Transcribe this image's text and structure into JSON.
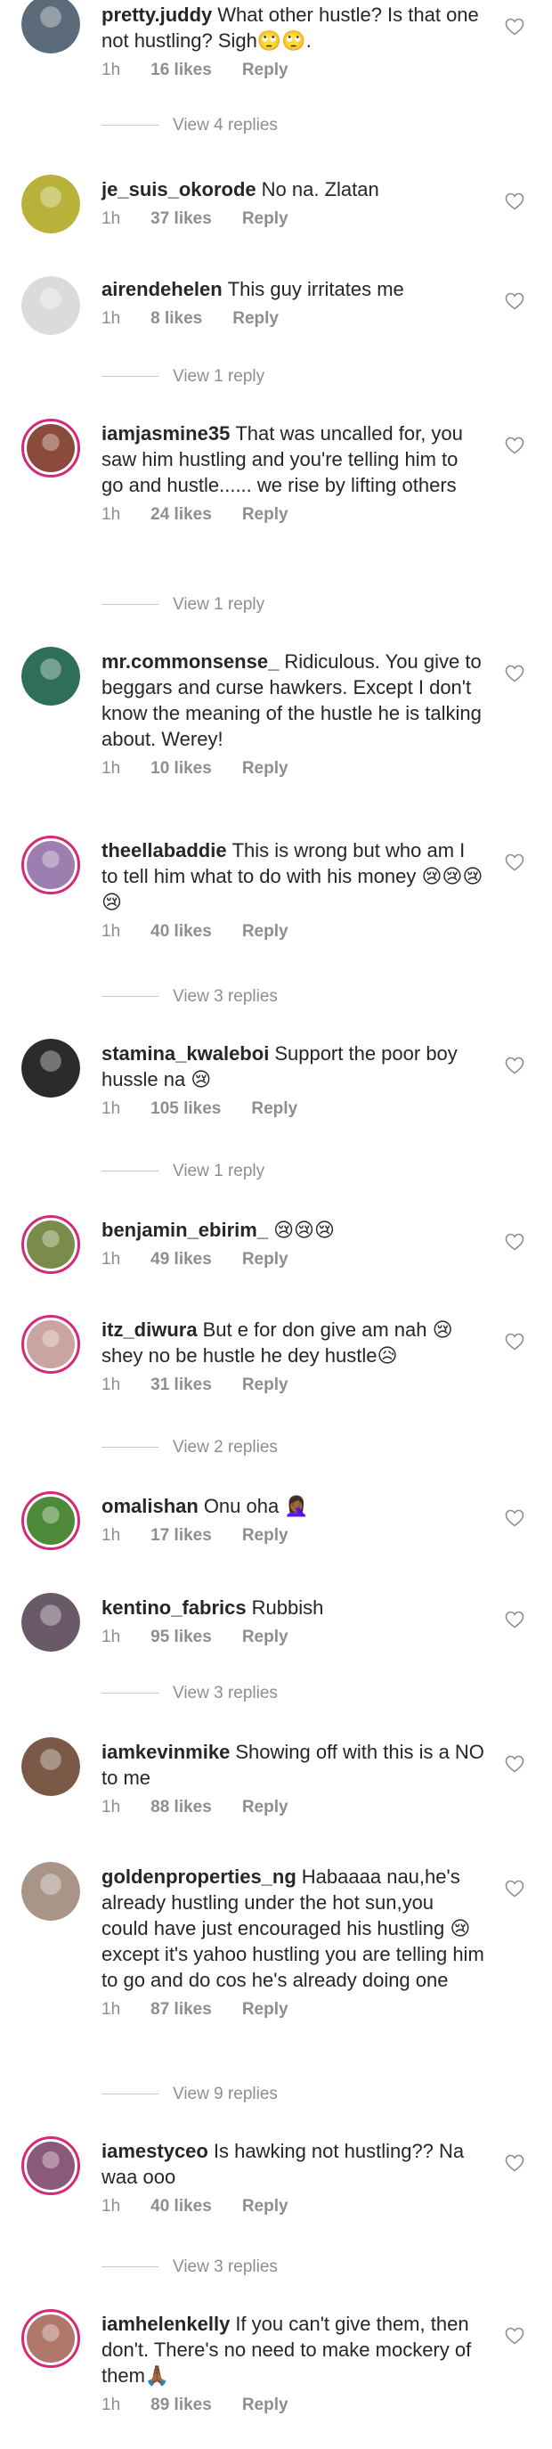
{
  "comments": [
    {
      "user": "pretty.juddy",
      "text": "What other hustle? Is that one not hustling? Sigh🙄🙄.",
      "time": "1h",
      "likes": "16 likes",
      "reply": "Reply",
      "view_replies": "View 4 replies",
      "avatar_color": "#5b6b7a"
    },
    {
      "user": "je_suis_okorode",
      "text": "No na. Zlatan",
      "time": "1h",
      "likes": "37 likes",
      "reply": "Reply",
      "view_replies": "",
      "avatar_color": "#b8b23a"
    },
    {
      "user": "airendehelen",
      "text": "This guy irritates me",
      "time": "1h",
      "likes": "8 likes",
      "reply": "Reply",
      "view_replies": "View 1 reply",
      "avatar_color": "#dbdbdb"
    },
    {
      "user": "iamjasmine35",
      "text": "That was uncalled for, you saw him hustling and you're telling him to go and hustle...... we rise by lifting others",
      "time": "1h",
      "likes": "24 likes",
      "reply": "Reply",
      "view_replies": "View 1 reply",
      "avatar_color": "#8a4b3c"
    },
    {
      "user": "mr.commonsense_",
      "text": "Ridiculous. You give to beggars and curse hawkers. Except I don't know the meaning of the hustle he is talking about. Werey!",
      "time": "1h",
      "likes": "10 likes",
      "reply": "Reply",
      "view_replies": "",
      "avatar_color": "#2f6f5a"
    },
    {
      "user": "theellabaddie",
      "text": "This is wrong but who am I to tell him what to do with his money 😢😢😢😢",
      "time": "1h",
      "likes": "40 likes",
      "reply": "Reply",
      "view_replies": "View 3 replies",
      "avatar_color": "#9c7fb0"
    },
    {
      "user": "stamina_kwaleboi",
      "text": "Support the poor boy hussle na 😢",
      "time": "1h",
      "likes": "105 likes",
      "reply": "Reply",
      "view_replies": "View 1 reply",
      "avatar_color": "#2b2b2b"
    },
    {
      "user": "benjamin_ebirim_",
      "text": "😢😢😢",
      "time": "1h",
      "likes": "49 likes",
      "reply": "Reply",
      "view_replies": "",
      "avatar_color": "#7b8c4a"
    },
    {
      "user": "itz_diwura",
      "text": "But e for don give am nah 😢 shey no be hustle he dey hustle😥",
      "time": "1h",
      "likes": "31 likes",
      "reply": "Reply",
      "view_replies": "View 2 replies",
      "avatar_color": "#c9a4a0"
    },
    {
      "user": "omalishan",
      "text": "Onu oha 🤦🏾‍♀️",
      "time": "1h",
      "likes": "17 likes",
      "reply": "Reply",
      "view_replies": "",
      "avatar_color": "#4f8a3b"
    },
    {
      "user": "kentino_fabrics",
      "text": "Rubbish",
      "time": "1h",
      "likes": "95 likes",
      "reply": "Reply",
      "view_replies": "View 3 replies",
      "avatar_color": "#6a5a68"
    },
    {
      "user": "iamkevinmike",
      "text": "Showing off with this is a NO to me",
      "time": "1h",
      "likes": "88 likes",
      "reply": "Reply",
      "view_replies": "",
      "avatar_color": "#7a5a46"
    },
    {
      "user": "goldenproperties_ng",
      "text": "Habaaaa nau,he's already hustling under the hot sun,you could have just encouraged his hustling 😢 except it's yahoo hustling you are telling him to go and do cos he's already doing one",
      "time": "1h",
      "likes": "87 likes",
      "reply": "Reply",
      "view_replies": "View 9 replies",
      "avatar_color": "#a99588"
    },
    {
      "user": "iamestyceo",
      "text": "Is hawking not hustling?? Na waa ooo",
      "time": "1h",
      "likes": "40 likes",
      "reply": "Reply",
      "view_replies": "View 3 replies",
      "avatar_color": "#8a5a7a"
    },
    {
      "user": "iamhelenkelly",
      "text": "If you can't give them, then don't. There's no need to make mockery of them🙏🏾",
      "time": "1h",
      "likes": "89 likes",
      "reply": "Reply",
      "view_replies": "",
      "avatar_color": "#b0786a"
    }
  ]
}
